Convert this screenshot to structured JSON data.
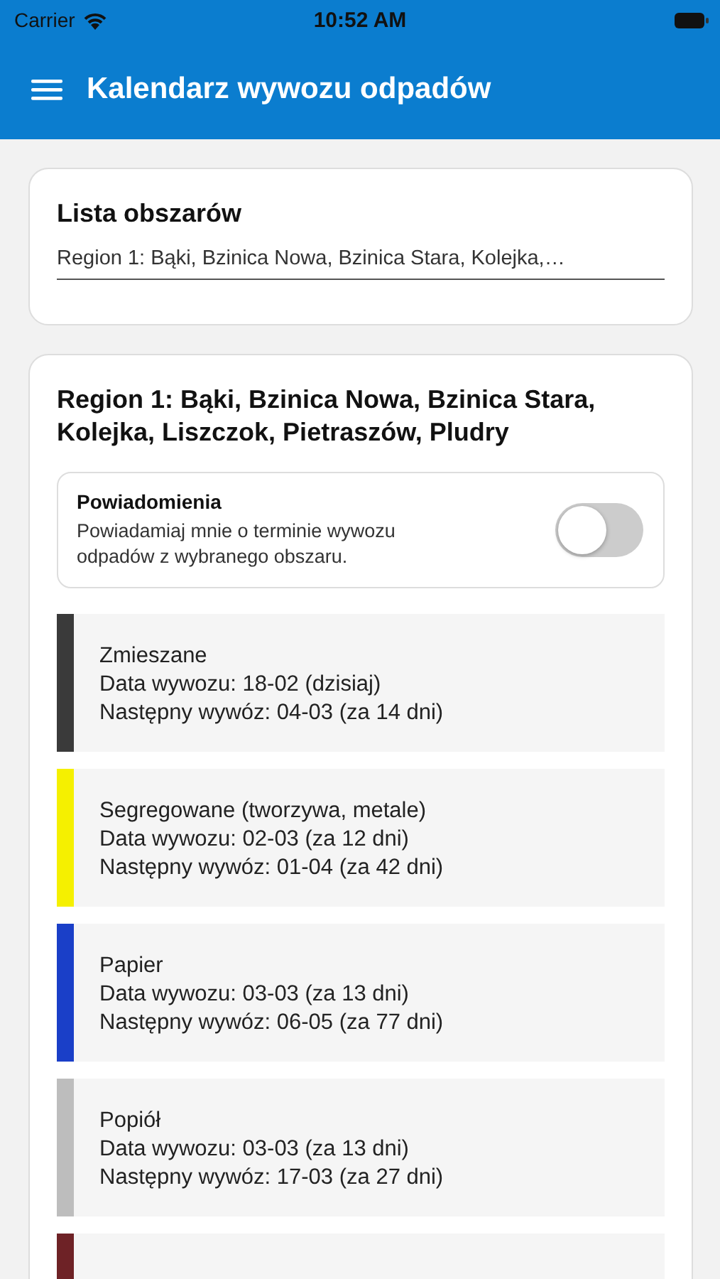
{
  "status_bar": {
    "carrier": "Carrier",
    "time": "10:52 AM"
  },
  "app_bar": {
    "title": "Kalendarz wywozu odpadów"
  },
  "area_list": {
    "title": "Lista obszarów",
    "value": "Region 1: Bąki, Bzinica Nowa, Bzinica Stara, Kolejka,…"
  },
  "region": {
    "title": "Region 1: Bąki, Bzinica Nowa, Bzinica Stara, Kolejka, Liszczok, Pietraszów, Pludry",
    "notifications": {
      "title": "Powiadomienia",
      "description": "Powiadamiaj mnie o terminie wywozu odpadów z wybranego obszaru.",
      "on": false
    },
    "waste_types": [
      {
        "name": "Zmieszane",
        "pickup": "Data wywozu: 18-02 (dzisiaj)",
        "next": "Następny wywóz: 04-03 (za 14 dni)",
        "color": "#3a3a3a"
      },
      {
        "name": "Segregowane (tworzywa, metale)",
        "pickup": "Data wywozu: 02-03 (za 12 dni)",
        "next": "Następny wywóz: 01-04 (za 42 dni)",
        "color": "#f5f000"
      },
      {
        "name": "Papier",
        "pickup": "Data wywozu: 03-03 (za 13 dni)",
        "next": "Następny wywóz: 06-05 (za 77 dni)",
        "color": "#1a3fc8"
      },
      {
        "name": "Popiół",
        "pickup": "Data wywozu: 03-03 (za 13 dni)",
        "next": "Następny wywóz: 17-03 (za 27 dni)",
        "color": "#bdbdbd"
      },
      {
        "color": "#6e2226"
      }
    ]
  }
}
